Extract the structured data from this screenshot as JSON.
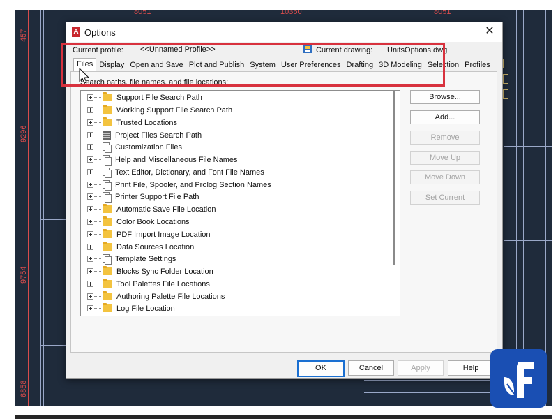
{
  "backdrop": {
    "dimensions": [
      "8051",
      "10360",
      "8051",
      "457",
      "9296",
      "9754",
      "6858"
    ]
  },
  "dialog": {
    "title": "Options",
    "close_glyph": "✕",
    "current_profile_label": "Current profile:",
    "current_profile_value": "<<Unnamed Profile>>",
    "current_drawing_label": "Current drawing:",
    "current_drawing_value": "UnitsOptions.dwg",
    "tabs": [
      {
        "label": "Files",
        "active": true
      },
      {
        "label": "Display"
      },
      {
        "label": "Open and Save"
      },
      {
        "label": "Plot and Publish"
      },
      {
        "label": "System"
      },
      {
        "label": "User Preferences"
      },
      {
        "label": "Drafting"
      },
      {
        "label": "3D Modeling"
      },
      {
        "label": "Selection"
      },
      {
        "label": "Profiles"
      }
    ],
    "search_label": "Search paths, file names, and file locations:",
    "tree_items": [
      {
        "label": "Support File Search Path",
        "icon": "folder-icon"
      },
      {
        "label": "Working Support File Search Path",
        "icon": "folder-icon"
      },
      {
        "label": "Trusted Locations",
        "icon": "folder-icon"
      },
      {
        "label": "Project Files Search Path",
        "icon": "project-icon"
      },
      {
        "label": "Customization Files",
        "icon": "files-icon"
      },
      {
        "label": "Help and Miscellaneous File Names",
        "icon": "files-icon"
      },
      {
        "label": "Text Editor, Dictionary, and Font File Names",
        "icon": "files-icon"
      },
      {
        "label": "Print File, Spooler, and Prolog Section Names",
        "icon": "files-icon"
      },
      {
        "label": "Printer Support File Path",
        "icon": "files-icon"
      },
      {
        "label": "Automatic Save File Location",
        "icon": "folder-icon"
      },
      {
        "label": "Color Book Locations",
        "icon": "folder-icon"
      },
      {
        "label": "PDF Import Image Location",
        "icon": "folder-icon"
      },
      {
        "label": "Data Sources Location",
        "icon": "folder-icon"
      },
      {
        "label": "Template Settings",
        "icon": "files-icon"
      },
      {
        "label": "Blocks Sync Folder Location",
        "icon": "folder-icon"
      },
      {
        "label": "Tool Palettes File Locations",
        "icon": "folder-icon"
      },
      {
        "label": "Authoring Palette File Locations",
        "icon": "folder-icon"
      },
      {
        "label": "Log File Location",
        "icon": "folder-icon"
      }
    ],
    "side_buttons": [
      {
        "label": "Browse...",
        "enabled": true
      },
      {
        "label": "Add...",
        "enabled": true
      },
      {
        "label": "Remove",
        "enabled": false
      },
      {
        "label": "Move Up",
        "enabled": false
      },
      {
        "label": "Move Down",
        "enabled": false
      },
      {
        "label": "Set Current",
        "enabled": false
      }
    ],
    "footer_buttons": {
      "ok": "OK",
      "cancel": "Cancel",
      "apply": "Apply",
      "help": "Help"
    }
  },
  "colors": {
    "highlight_box": "#d8323e",
    "cad_background": "#1f2b3b",
    "brand_blue": "#1a4fb3"
  }
}
